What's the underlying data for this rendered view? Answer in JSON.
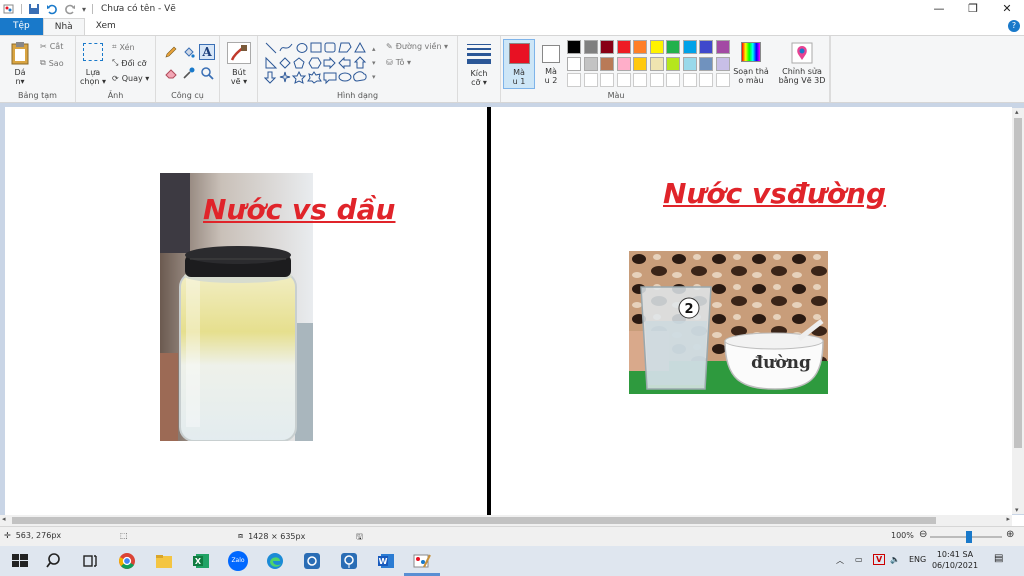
{
  "window": {
    "title": "Chưa có tên - Vẽ"
  },
  "tabs": [
    {
      "label": "Tệp"
    },
    {
      "label": "Nhà"
    },
    {
      "label": "Xem"
    }
  ],
  "ribbon": {
    "clipboard": {
      "paste_line1": "Dá",
      "paste_line2": "n▾",
      "cut": "Cắt",
      "copy": "Sao",
      "label": "Bảng tạm"
    },
    "image": {
      "select_line1": "Lựa",
      "select_line2": "chọn ▾",
      "crop": "Xén",
      "resize": "Đổi cỡ",
      "rotate": "Quay ▾",
      "label": "Ảnh"
    },
    "tools": {
      "label": "Công cụ"
    },
    "brushes": {
      "line1": "Bút",
      "line2": "vẽ ▾"
    },
    "shapes": {
      "outline": "Đường viền ▾",
      "fill": "Tô ▾",
      "label": "Hình dạng"
    },
    "size": {
      "line1": "Kích",
      "line2": "cỡ ▾"
    },
    "colors": {
      "color1_line1": "Mà",
      "color1_line2": "u 1",
      "color2_line1": "Mà",
      "color2_line2": "u 2",
      "edit_line1": "Soạn thả",
      "edit_line2": "o màu",
      "paint3d_line1": "Chỉnh sửa",
      "paint3d_line2": "bằng Vẽ 3D",
      "label": "Màu",
      "color1_value": "#e81123",
      "color2_value": "#ffffff",
      "palette_row1": [
        "#000000",
        "#7f7f7f",
        "#880015",
        "#ed1c24",
        "#ff7f27",
        "#fff200",
        "#22b14c",
        "#00a2e8",
        "#3f48cc",
        "#a349a4"
      ],
      "palette_row2": [
        "#ffffff",
        "#c3c3c3",
        "#b97a57",
        "#ffaec9",
        "#ffc90e",
        "#efe4b0",
        "#b5e61d",
        "#99d9ea",
        "#7092be",
        "#c8bfe7"
      ]
    }
  },
  "canvas": {
    "left_heading": "Nước vs dầu",
    "right_heading": "Nước vsđường",
    "bowl_label": "đường",
    "glass_number": "2"
  },
  "status": {
    "cursor_pos": "563, 276px",
    "image_size": "1428 × 635px",
    "zoom": "100%"
  },
  "taskbar": {
    "lang": "ENG",
    "time": "10:41 SA",
    "date": "06/10/2021",
    "zalo": "Zalo"
  }
}
